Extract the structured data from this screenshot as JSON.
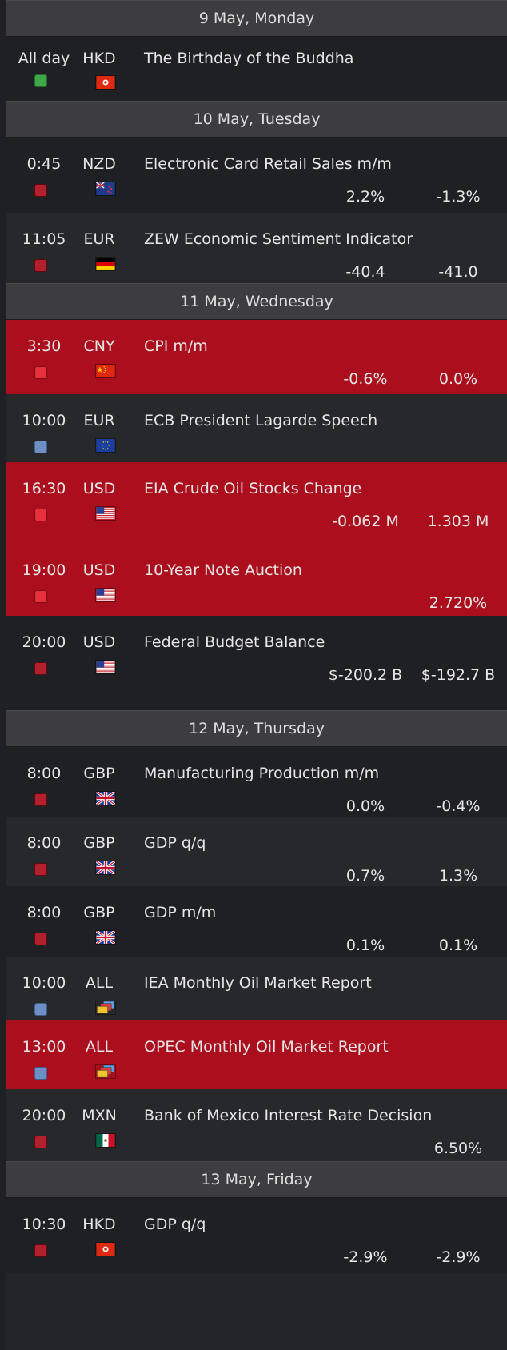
{
  "days": [
    {
      "header": "9 May, Monday",
      "events": [
        {
          "time": "All day",
          "currency": "HKD",
          "title": "The Birthday of the Buddha",
          "importance": "holiday",
          "flag": "hk-flag",
          "v1": "",
          "v2": ""
        }
      ]
    },
    {
      "header": "10 May, Tuesday",
      "events": [
        {
          "time": "0:45",
          "currency": "NZD",
          "title": "Electronic Card Retail Sales m/m",
          "importance": "high",
          "flag": "nz-flag",
          "v1": "2.2%",
          "v2": "-1.3%"
        },
        {
          "time": "11:05",
          "currency": "EUR",
          "title": "ZEW Economic Sentiment Indicator",
          "importance": "high",
          "flag": "de-flag",
          "v1": "-40.4",
          "v2": "-41.0"
        }
      ]
    },
    {
      "header": "11 May, Wednesday",
      "events": [
        {
          "time": "3:30",
          "currency": "CNY",
          "title": "CPI m/m",
          "importance": "high",
          "flag": "cn-flag",
          "v1": "-0.6%",
          "v2": "0.0%",
          "highlight": true
        },
        {
          "time": "10:00",
          "currency": "EUR",
          "title": "ECB President Lagarde Speech",
          "importance": "low",
          "flag": "eu-flag",
          "v1": "",
          "v2": ""
        },
        {
          "time": "16:30",
          "currency": "USD",
          "title": "EIA Crude Oil Stocks Change",
          "importance": "high",
          "flag": "us-flag",
          "v1": "-0.062 M",
          "v2": "1.303 M",
          "highlight": true
        },
        {
          "time": "19:00",
          "currency": "USD",
          "title": "10-Year Note Auction",
          "importance": "high",
          "flag": "us-flag",
          "v1": "",
          "v2": "2.720%",
          "highlight": true
        },
        {
          "time": "20:00",
          "currency": "USD",
          "title": "Federal Budget Balance",
          "importance": "high",
          "flag": "us-flag",
          "v1": "$-200.2 B",
          "v2": "$-192.7 B"
        }
      ]
    },
    {
      "header": "12 May, Thursday",
      "events": [
        {
          "time": "8:00",
          "currency": "GBP",
          "title": "Manufacturing Production m/m",
          "importance": "high",
          "flag": "gb-flag",
          "v1": "0.0%",
          "v2": "-0.4%"
        },
        {
          "time": "8:00",
          "currency": "GBP",
          "title": "GDP q/q",
          "importance": "high",
          "flag": "gb-flag",
          "v1": "0.7%",
          "v2": "1.3%"
        },
        {
          "time": "8:00",
          "currency": "GBP",
          "title": "GDP m/m",
          "importance": "high",
          "flag": "gb-flag",
          "v1": "0.1%",
          "v2": "0.1%"
        },
        {
          "time": "10:00",
          "currency": "ALL",
          "title": "IEA Monthly Oil Market Report",
          "importance": "low",
          "flag": "all-flag",
          "v1": "",
          "v2": ""
        },
        {
          "time": "13:00",
          "currency": "ALL",
          "title": "OPEC Monthly Oil Market Report",
          "importance": "low",
          "flag": "all-flag",
          "v1": "",
          "v2": "",
          "highlight": true
        },
        {
          "time": "20:00",
          "currency": "MXN",
          "title": "Bank of Mexico Interest Rate Decision",
          "importance": "high",
          "flag": "mx-flag",
          "v1": "",
          "v2": "6.50%"
        }
      ]
    },
    {
      "header": "13 May, Friday",
      "events": [
        {
          "time": "10:30",
          "currency": "HKD",
          "title": "GDP q/q",
          "importance": "high",
          "flag": "hk-flag",
          "v1": "-2.9%",
          "v2": "-2.9%"
        }
      ]
    }
  ]
}
